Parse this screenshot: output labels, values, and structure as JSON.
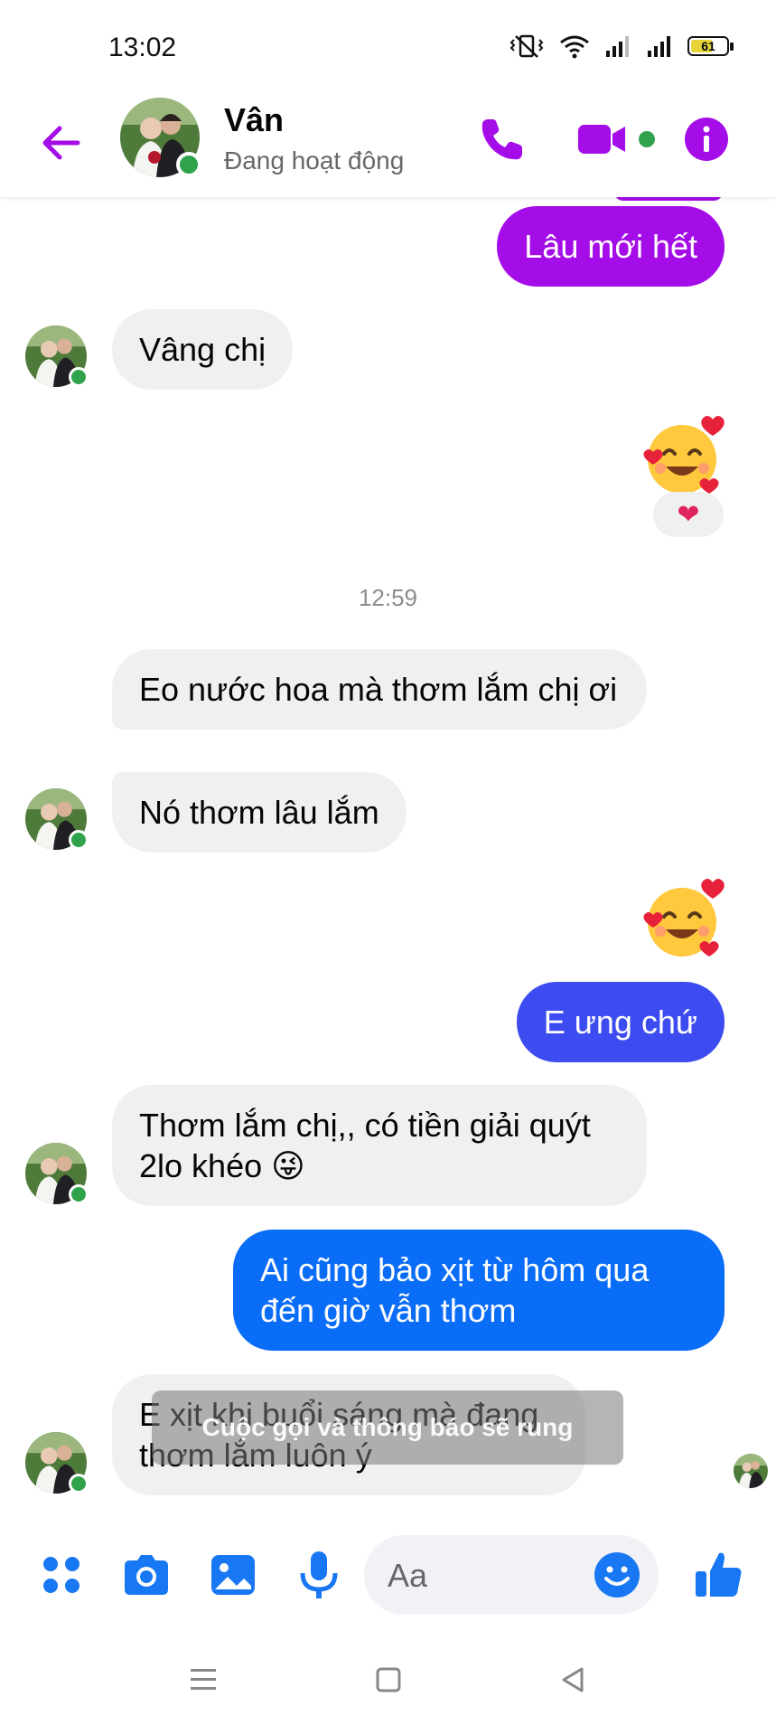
{
  "status": {
    "time": "13:02",
    "battery": "61"
  },
  "header": {
    "name": "Vân",
    "presence": "Đang hoạt động"
  },
  "colors": {
    "accent": "#a40de8",
    "online": "#31a24c",
    "blue_bubble": "#0a6df8",
    "indigo_bubble": "#3d4cf0"
  },
  "messages": {
    "m1": "Lâu mới hết",
    "m2": "Vâng chị",
    "m3_reaction": "❤",
    "timestamp": "12:59",
    "m4": "Eo nước hoa mà thơm lắm chị ơi",
    "m5": "Nó thơm lâu lắm",
    "m6": "E ưng chứ",
    "m7": "Thơm lắm chị,, có tiền giải quýt 2lo khéo 😜",
    "m8": "Ai cũng bảo xịt từ hôm qua đến giờ vẫn thơm",
    "m9": "E xịt khi buổi sáng mà đang thơm lắm luôn ý"
  },
  "toast": "Cuộc gọi và thông báo sẽ rung",
  "composer": {
    "placeholder": "Aa"
  }
}
